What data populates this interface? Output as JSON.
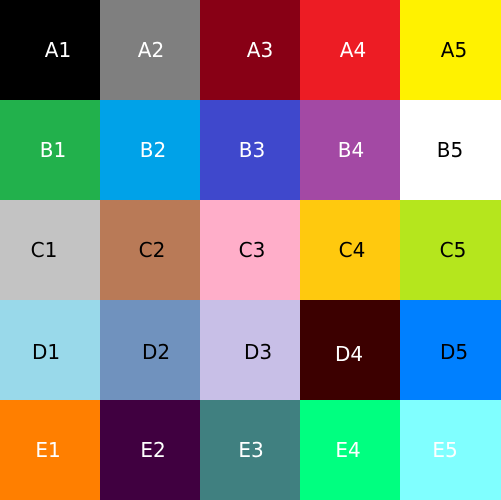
{
  "cells": [
    {
      "label": "A1",
      "bg": "#000000",
      "fg": "#ffffff"
    },
    {
      "label": "A2",
      "bg": "#7f7f7f",
      "fg": "#ffffff"
    },
    {
      "label": "A3",
      "bg": "#880015",
      "fg": "#ffffff"
    },
    {
      "label": "A4",
      "bg": "#ed1c24",
      "fg": "#ffffff"
    },
    {
      "label": "A5",
      "bg": "#fff200",
      "fg": "#000000"
    },
    {
      "label": "B1",
      "bg": "#22b14c",
      "fg": "#ffffff"
    },
    {
      "label": "B2",
      "bg": "#00a2e8",
      "fg": "#ffffff"
    },
    {
      "label": "B3",
      "bg": "#3f48cc",
      "fg": "#ffffff"
    },
    {
      "label": "B4",
      "bg": "#a349a4",
      "fg": "#ffffff"
    },
    {
      "label": "B5",
      "bg": "#ffffff",
      "fg": "#000000"
    },
    {
      "label": "C1",
      "bg": "#c3c3c3",
      "fg": "#000000"
    },
    {
      "label": "C2",
      "bg": "#b97a57",
      "fg": "#000000"
    },
    {
      "label": "C3",
      "bg": "#ffaec9",
      "fg": "#000000"
    },
    {
      "label": "C4",
      "bg": "#ffc90e",
      "fg": "#000000"
    },
    {
      "label": "C5",
      "bg": "#b5e61d",
      "fg": "#000000"
    },
    {
      "label": "D1",
      "bg": "#99d9ea",
      "fg": "#000000"
    },
    {
      "label": "D2",
      "bg": "#7092be",
      "fg": "#000000"
    },
    {
      "label": "D3",
      "bg": "#c8bfe7",
      "fg": "#000000"
    },
    {
      "label": "D4",
      "bg": "#3c0000",
      "fg": "#ffffff"
    },
    {
      "label": "D5",
      "bg": "#0080ff",
      "fg": "#000000"
    },
    {
      "label": "E1",
      "bg": "#ff7f00",
      "fg": "#ffffff"
    },
    {
      "label": "E2",
      "bg": "#400040",
      "fg": "#ffffff"
    },
    {
      "label": "E3",
      "bg": "#408080",
      "fg": "#ffffff"
    },
    {
      "label": "E4",
      "bg": "#00ff80",
      "fg": "#ffffff"
    },
    {
      "label": "E5",
      "bg": "#80ffff",
      "fg": "#ffffff"
    }
  ]
}
